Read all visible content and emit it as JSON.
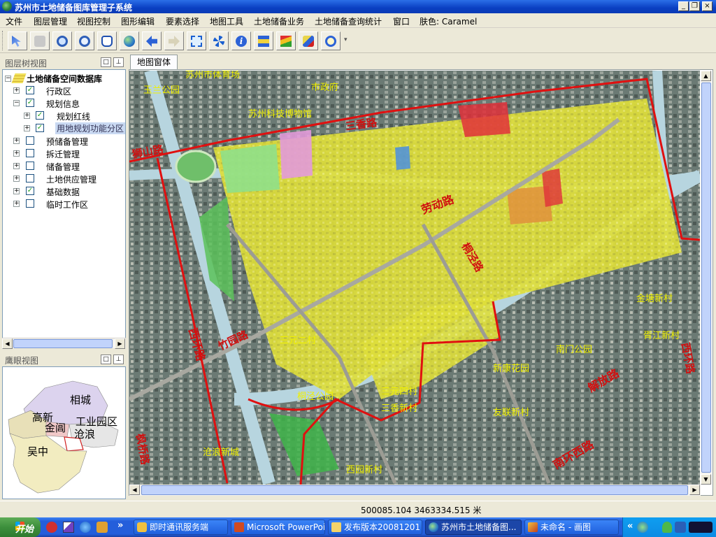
{
  "window": {
    "title": "苏州市土地储备图库管理子系统"
  },
  "menu": [
    "文件",
    "图层管理",
    "视图控制",
    "图形编辑",
    "要素选择",
    "地图工具",
    "土地储备业务",
    "土地储备查询统计",
    "窗口",
    "肤色: Caramel"
  ],
  "toolbar": {
    "icons": [
      "select-pointer-icon",
      "zoom-previous-icon",
      "zoom-in-icon",
      "zoom-out-icon",
      "pan-hand-icon",
      "globe-icon",
      "back-icon",
      "forward-icon",
      "full-extent-icon",
      "fixed-zoom-icon",
      "info-icon",
      "measure-icon",
      "layer-style-icon",
      "pin-icon",
      "find-icon"
    ]
  },
  "layer_tree": {
    "header": "图层树视图",
    "root": "土地储备空间数据库",
    "items": [
      {
        "label": "行政区",
        "checked": true,
        "expanded": false,
        "level": 1
      },
      {
        "label": "规划信息",
        "checked": true,
        "expanded": true,
        "level": 1
      },
      {
        "label": "规划红线",
        "checked": true,
        "expanded": false,
        "level": 2
      },
      {
        "label": "用地规划功能分区",
        "checked": true,
        "expanded": false,
        "level": 2,
        "selected": true
      },
      {
        "label": "预储备管理",
        "checked": false,
        "expanded": false,
        "level": 1
      },
      {
        "label": "拆迁管理",
        "checked": false,
        "expanded": false,
        "level": 1
      },
      {
        "label": "储备管理",
        "checked": false,
        "expanded": false,
        "level": 1
      },
      {
        "label": "土地供应管理",
        "checked": false,
        "expanded": false,
        "level": 1
      },
      {
        "label": "基础数据",
        "checked": true,
        "expanded": false,
        "level": 1
      },
      {
        "label": "临时工作区",
        "checked": false,
        "expanded": false,
        "level": 1
      }
    ]
  },
  "overview": {
    "header": "鹰眼视图",
    "districts": [
      "相城",
      "高新",
      "金阊",
      "工业园区",
      "沧浪",
      "吴中"
    ]
  },
  "map": {
    "tab": "地图窗体",
    "road_labels": [
      "劳动路",
      "南环西路",
      "解放路",
      "西环路",
      "竹园路",
      "狮山路",
      "桐泾路",
      "三香路",
      "西环路",
      "枫桥路"
    ],
    "place_labels": [
      "玉兰公园",
      "苏州市体育场",
      "市政府",
      "苏州科技博物馆",
      "金塘新村",
      "胥江新村",
      "南门公园",
      "三元二村",
      "新康花园",
      "桐泾公园",
      "三元四村",
      "三香新村",
      "友联新村",
      "沧浪新城",
      "西园新村"
    ],
    "colors": {
      "boundary": "#e01010",
      "parcel_yellow": "#e3e33a",
      "parcel_red": "#e0303a",
      "parcel_green": "#8fe08a",
      "parcel_pink": "#e29ad9",
      "parcel_orange": "#e0913c",
      "water": "#b7d5df"
    }
  },
  "status": {
    "coordinates": "500085.104  3463334.515 米"
  },
  "taskbar": {
    "start": "开始",
    "tasks": [
      {
        "label": "即时通讯服务端",
        "icon": "chat-icon",
        "active": false
      },
      {
        "label": "Microsoft PowerPoi...",
        "icon": "powerpoint-icon",
        "active": false
      },
      {
        "label": "发布版本20081201",
        "icon": "folder-icon",
        "active": false
      },
      {
        "label": "苏州市土地储备图...",
        "icon": "globe-app-icon",
        "active": true
      },
      {
        "label": "未命名 - 画图",
        "icon": "paint-icon",
        "active": false
      }
    ],
    "tray_text": "«"
  }
}
